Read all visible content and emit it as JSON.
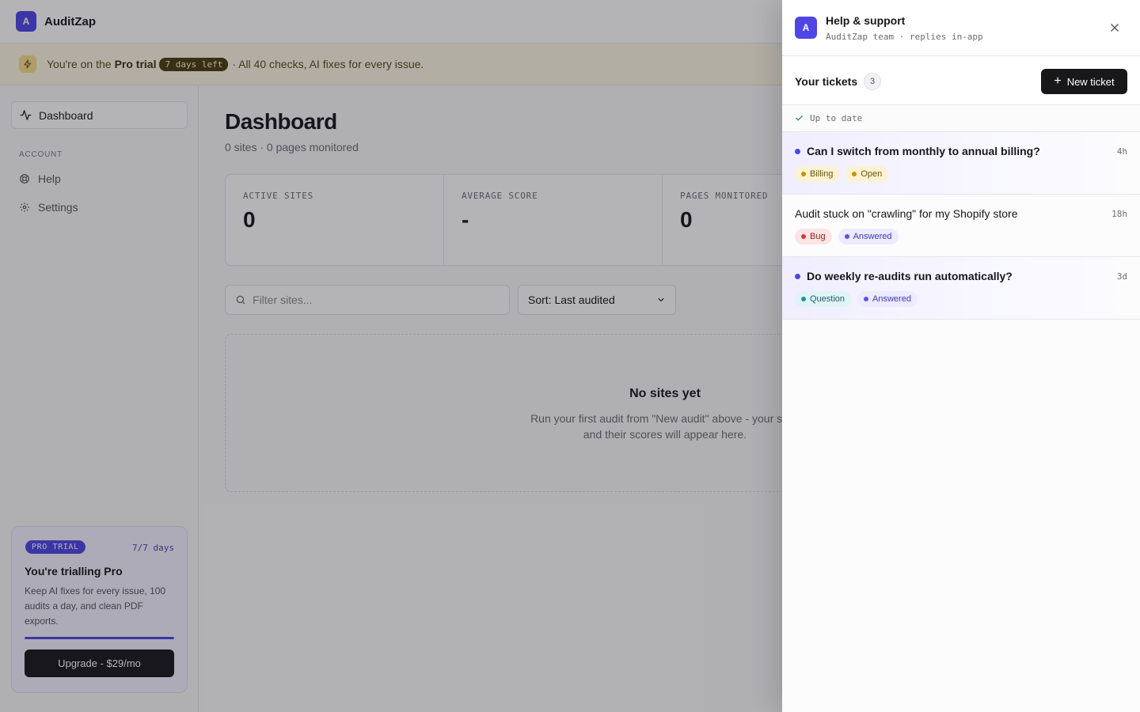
{
  "app": {
    "logo_letter": "A",
    "name": "AuditZap"
  },
  "banner": {
    "prefix": "You're on the",
    "plan": "Pro trial",
    "days_chip": "7 days left",
    "suffix": "· All 40 checks, AI fixes for every issue."
  },
  "sidebar": {
    "active_item": "Dashboard",
    "section_label": "ACCOUNT",
    "items": [
      {
        "label": "Help"
      },
      {
        "label": "Settings"
      }
    ],
    "trial_card": {
      "pill": "PRO TRIAL",
      "days": "7/7 days",
      "title": "You're trialling Pro",
      "description": "Keep AI fixes for every issue, 100 audits a day, and clean PDF exports.",
      "progress": 1.0,
      "upgrade_label": "Upgrade - $29/mo"
    }
  },
  "main": {
    "title": "Dashboard",
    "subtitle": "0 sites · 0 pages monitored",
    "stats": [
      {
        "label": "ACTIVE SITES",
        "value": "0"
      },
      {
        "label": "AVERAGE SCORE",
        "value": "-"
      },
      {
        "label": "PAGES MONITORED",
        "value": "0"
      }
    ],
    "filter_placeholder": "Filter sites...",
    "sort_label": "Sort: Last audited",
    "empty": {
      "title": "No sites yet",
      "description": "Run your first audit from \"New audit\" above - your sites and their scores will appear here."
    }
  },
  "help_panel": {
    "logo_letter": "A",
    "title": "Help & support",
    "subtitle": "AuditZap team · replies in-app",
    "tickets_label": "Your tickets",
    "tickets_count": "3",
    "new_ticket_label": "New ticket",
    "status": "Up to date",
    "tickets": [
      {
        "subject": "Can I switch from monthly to annual billing?",
        "time": "4h",
        "unread": true,
        "tags": [
          {
            "label": "Billing",
            "kind": "billing"
          },
          {
            "label": "Open",
            "kind": "open"
          }
        ]
      },
      {
        "subject": "Audit stuck on \"crawling\" for my Shopify store",
        "time": "18h",
        "unread": false,
        "tags": [
          {
            "label": "Bug",
            "kind": "bug"
          },
          {
            "label": "Answered",
            "kind": "answered"
          }
        ]
      },
      {
        "subject": "Do weekly re-audits run automatically?",
        "time": "3d",
        "unread": true,
        "tags": [
          {
            "label": "Question",
            "kind": "question"
          },
          {
            "label": "Answered",
            "kind": "answered"
          }
        ]
      }
    ]
  },
  "colors": {
    "accent": "#4f46e5",
    "banner_bg": "#fdf6e3",
    "button_dark": "#18181b",
    "overlay": "rgba(22,22,30,0.32)"
  }
}
